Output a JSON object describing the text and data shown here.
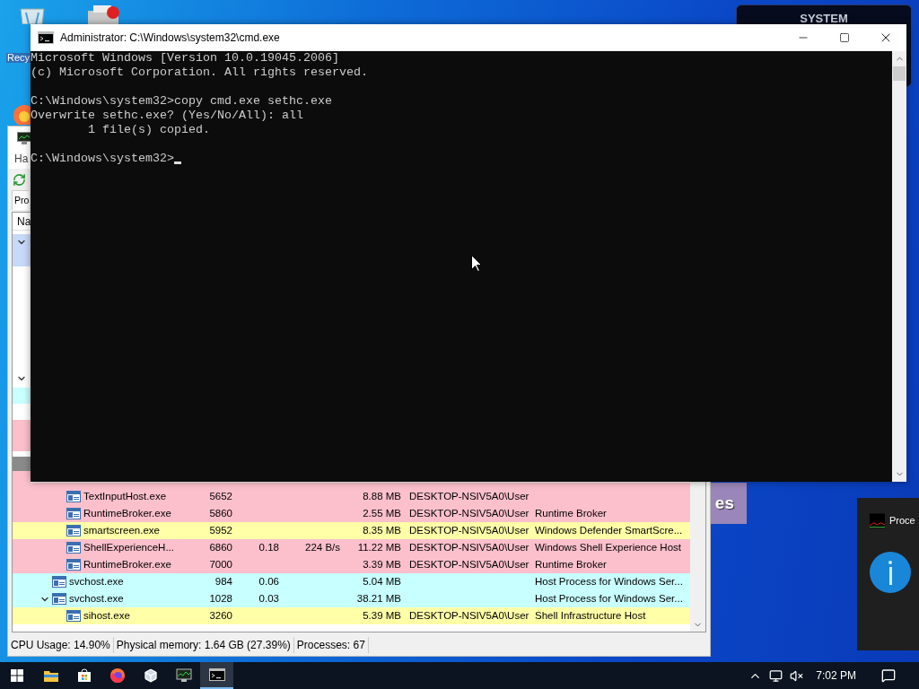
{
  "desktop": {
    "icon_label": "Recy",
    "system_panel": {
      "title": "SYSTEM"
    },
    "overlay_label": "es"
  },
  "process_hacker": {
    "menu_fragment": "Ha",
    "tab_fragment": "Pro",
    "column_fragment": "Na",
    "rows": [
      {
        "children": [
          {
            "name": "TextInputHost.exe",
            "pid": "5652",
            "memory": "8.88 MB",
            "user": "DESKTOP-NSIV5A0\\User",
            "color": "#fbc0cc",
            "expanded": false
          },
          {
            "name": "RuntimeBroker.exe",
            "pid": "5860",
            "memory": "2.55 MB",
            "user": "DESKTOP-NSIV5A0\\User",
            "description": "Runtime Broker",
            "color": "#fbc0cc",
            "expanded": false
          },
          {
            "name": "smartscreen.exe",
            "pid": "5952",
            "memory": "8.35 MB",
            "user": "DESKTOP-NSIV5A0\\User",
            "description": "Windows Defender SmartScre...",
            "color": "#ffffa8",
            "expanded": false
          },
          {
            "name": "ShellExperienceH...",
            "pid": "6860",
            "cpu": "0.18",
            "io": "224 B/s",
            "memory": "11.22 MB",
            "user": "DESKTOP-NSIV5A0\\User",
            "description": "Windows Shell Experience Host",
            "color": "#fbc0cc",
            "expanded": false
          },
          {
            "name": "RuntimeBroker.exe",
            "pid": "7000",
            "memory": "3.39 MB",
            "user": "DESKTOP-NSIV5A0\\User",
            "description": "Runtime Broker",
            "color": "#fbc0cc",
            "expanded": false
          }
        ]
      },
      {
        "name": "svchost.exe",
        "pid": "984",
        "cpu": "0.06",
        "memory": "5.04 MB",
        "description": "Host Process for Windows Ser...",
        "color": "#c8ffff",
        "expanded": false
      },
      {
        "name": "svchost.exe",
        "pid": "1028",
        "cpu": "0.03",
        "memory": "38.21 MB",
        "description": "Host Process for Windows Ser...",
        "color": "#c8ffff",
        "expanded": true,
        "children": [
          {
            "name": "sihost.exe",
            "pid": "3260",
            "memory": "5.39 MB",
            "user": "DESKTOP-NSIV5A0\\User",
            "description": "Shell Infrastructure Host",
            "color": "#ffffa8",
            "expanded": false
          }
        ]
      }
    ],
    "status_bar": [
      "CPU Usage: 14.90%",
      "Physical memory: 1.64 GB (27.39%)",
      "Processes: 67"
    ]
  },
  "cmd": {
    "title": "Administrator: C:\\Windows\\system32\\cmd.exe",
    "blocks": [
      [
        "Microsoft Windows [Version 10.0.19045.2006]",
        "(c) Microsoft Corporation. All rights reserved."
      ],
      [
        "C:\\Windows\\system32>copy cmd.exe sethc.exe",
        "Overwrite sethc.exe? (Yes/No/All): all",
        "        1 file(s) copied."
      ],
      [
        "C:\\Windows\\system32>"
      ]
    ]
  },
  "notification": {
    "title": "Proce"
  },
  "taskbar": {
    "apps": [
      {
        "kind": "explorer",
        "selected": false
      },
      {
        "kind": "store",
        "selected": false
      },
      {
        "kind": "firefox",
        "selected": false
      },
      {
        "kind": "cube",
        "selected": false
      },
      {
        "kind": "monitor",
        "selected": false
      },
      {
        "kind": "terminal",
        "selected": true
      }
    ],
    "clock": "7:02 PM"
  }
}
